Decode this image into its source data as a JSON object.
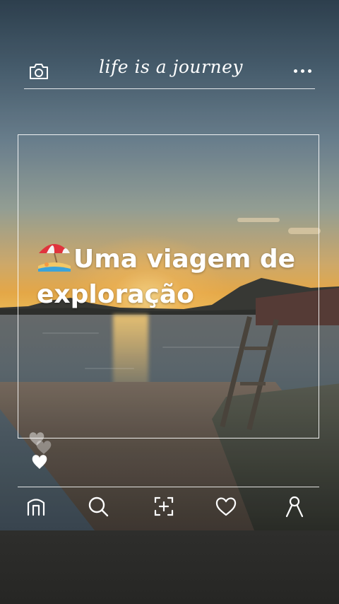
{
  "header": {
    "title": "life is a journey",
    "camera_icon": "camera-icon",
    "more_icon": "more-horizontal-icon"
  },
  "post": {
    "caption": "Uma viagem de exploração",
    "caption_emoji_icon": "beach-umbrella-icon",
    "like_icons": [
      "heart-outline-icon",
      "heart-filled-icon"
    ]
  },
  "nav": {
    "items": [
      {
        "icon": "home-icon"
      },
      {
        "icon": "search-icon"
      },
      {
        "icon": "add-post-icon"
      },
      {
        "icon": "heart-icon"
      },
      {
        "icon": "profile-icon"
      }
    ]
  },
  "colors": {
    "ui_stroke": "#ffffff",
    "sunset_orange": "#f2b04a",
    "sky_blue": "#4a6071"
  }
}
